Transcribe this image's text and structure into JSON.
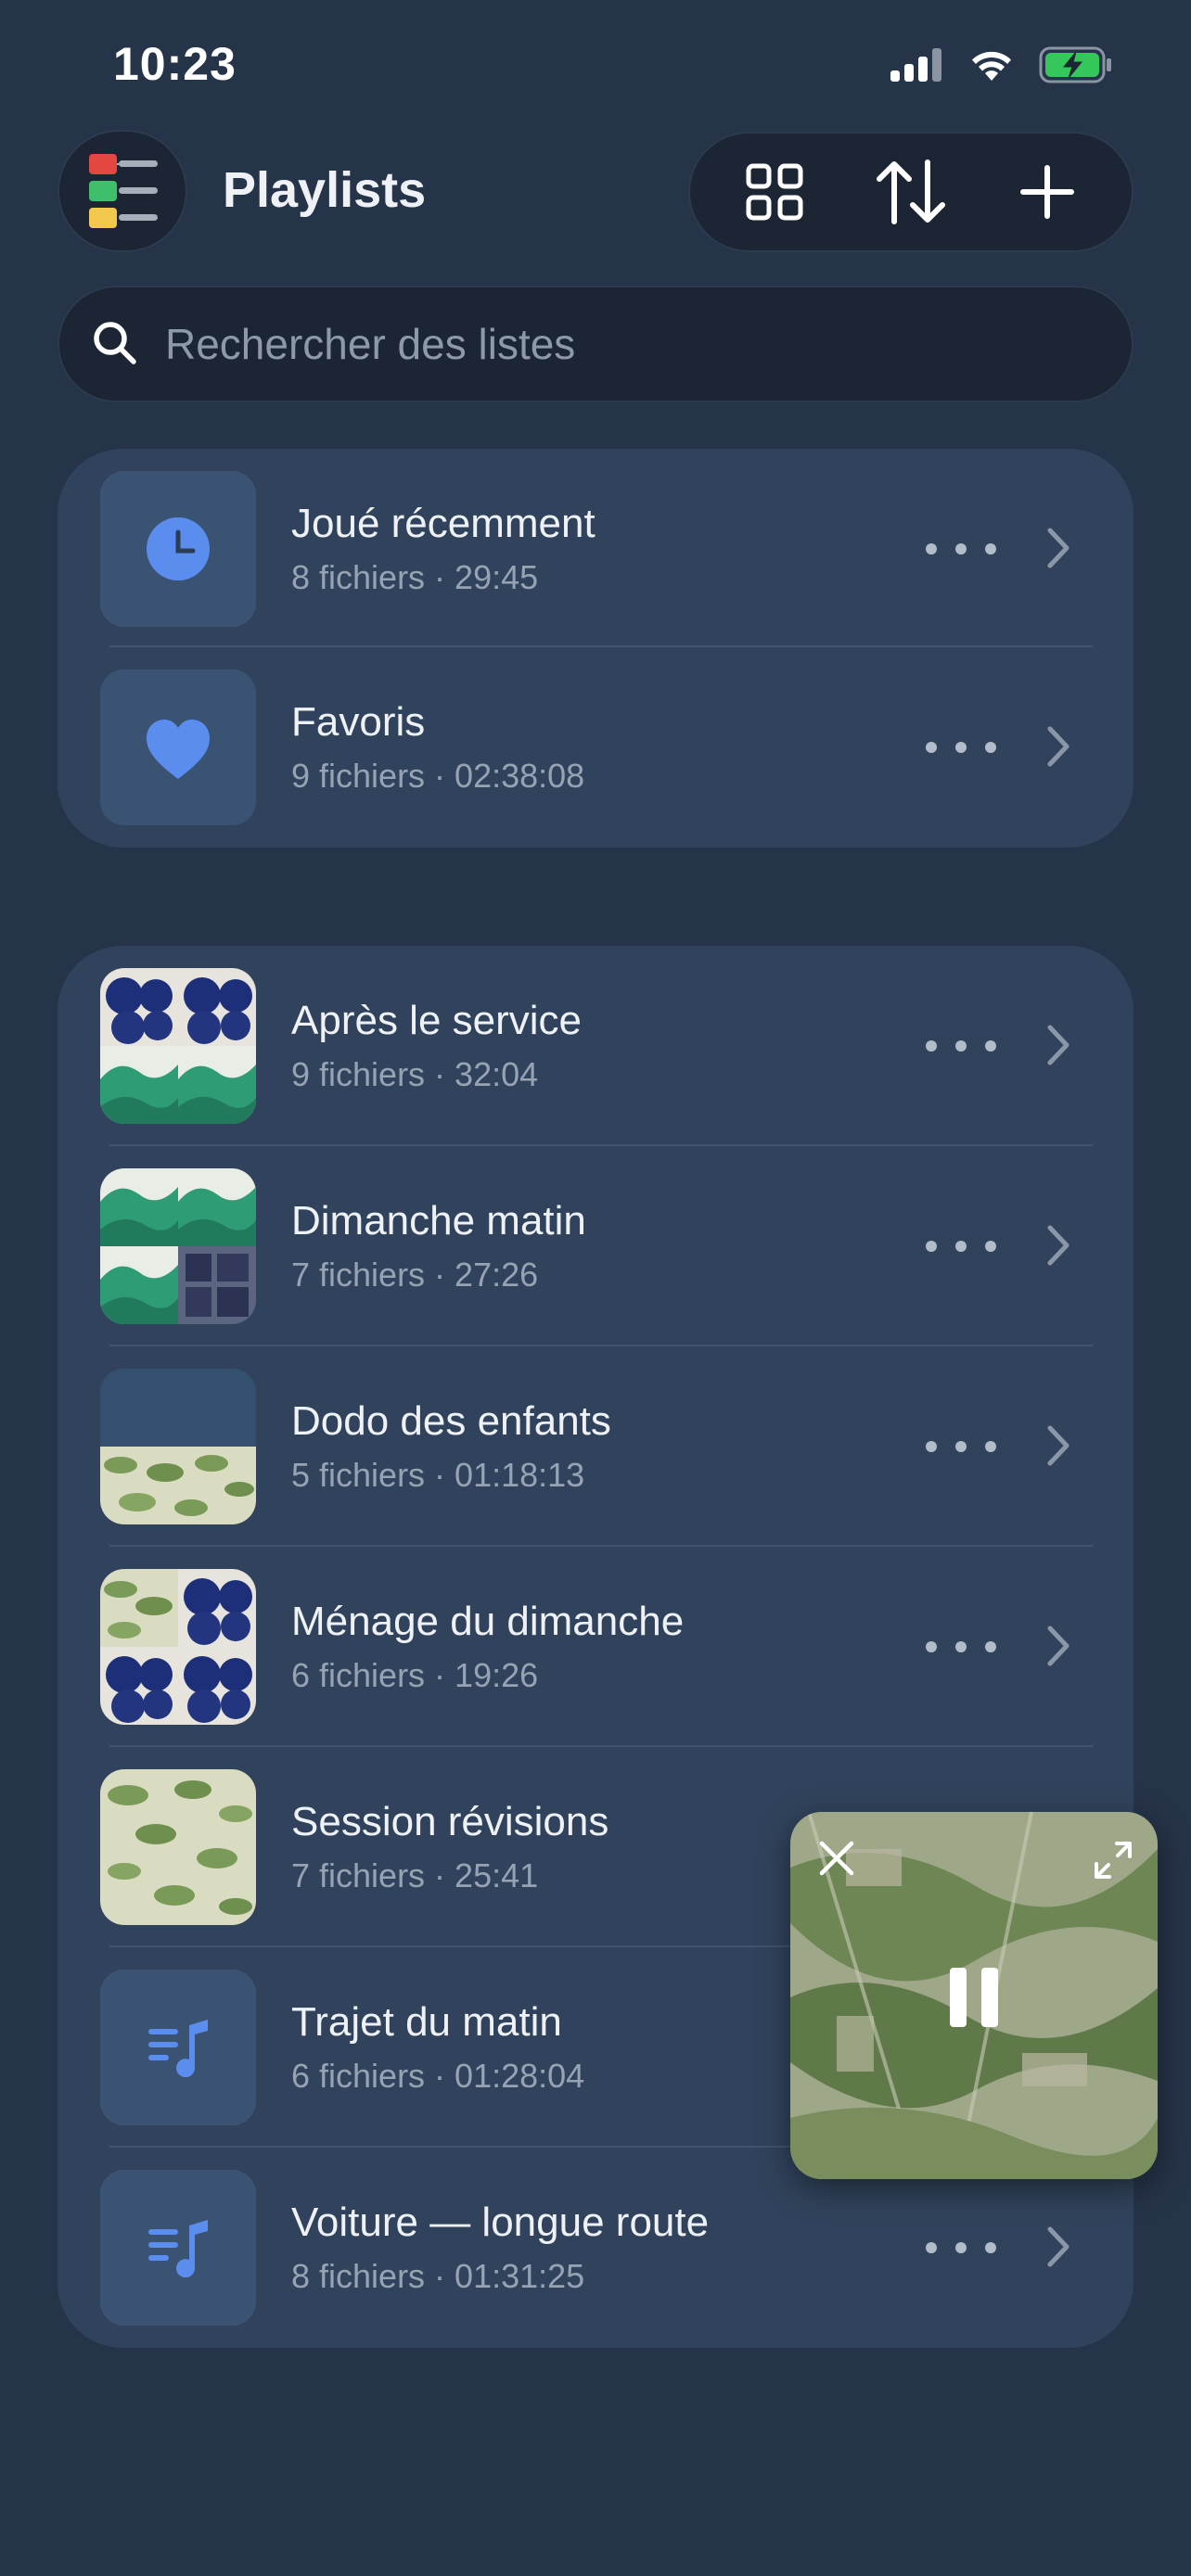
{
  "status_bar": {
    "time": "10:23"
  },
  "header": {
    "title": "Playlists"
  },
  "search": {
    "placeholder": "Rechercher des listes"
  },
  "smart_lists": [
    {
      "title": "Joué récemment",
      "subtitle": "8 fichiers · 29:45",
      "icon": "clock-icon"
    },
    {
      "title": "Favoris",
      "subtitle": "9 fichiers · 02:38:08",
      "icon": "heart-icon"
    }
  ],
  "playlists": [
    {
      "title": "Après le service",
      "subtitle": "9 fichiers · 32:04",
      "thumb": "mosaic-blue-green"
    },
    {
      "title": "Dimanche matin",
      "subtitle": "7 fichiers · 27:26",
      "thumb": "mosaic-green-windows"
    },
    {
      "title": "Dodo des enfants",
      "subtitle": "5 fichiers · 01:18:13",
      "thumb": "half-leaves"
    },
    {
      "title": "Ménage du dimanche",
      "subtitle": "6 fichiers · 19:26",
      "thumb": "mosaic-leaves-blue"
    },
    {
      "title": "Session révisions",
      "subtitle": "7 fichiers · 25:41",
      "thumb": "leaves"
    },
    {
      "title": "Trajet du matin",
      "subtitle": "6 fichiers · 01:28:04",
      "thumb": "music-list-icon"
    },
    {
      "title": "Voiture — longue route",
      "subtitle": "8 fichiers · 01:31:25",
      "thumb": "music-list-icon"
    }
  ],
  "colors": {
    "background": "#263449",
    "card": "#31435c",
    "accent": "#5b8def",
    "battery": "#34c759"
  }
}
